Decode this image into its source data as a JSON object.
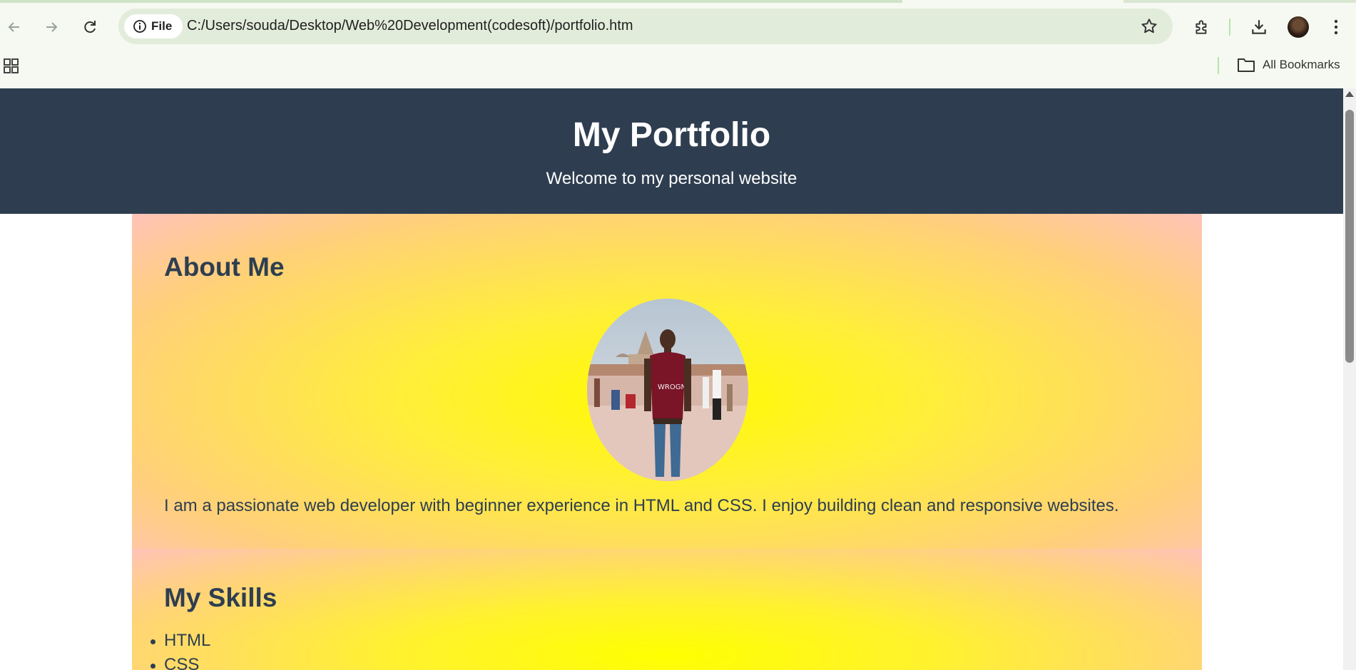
{
  "browser": {
    "site_chip_label": "File",
    "url": "C:/Users/souda/Desktop/Web%20Development(codesoft)/portfolio.htm",
    "bookmarks_label": "All Bookmarks",
    "icons": [
      "back-icon",
      "forward-icon",
      "reload-icon",
      "info-icon",
      "star-icon",
      "extensions-icon",
      "download-icon",
      "avatar",
      "menu-icon",
      "apps-icon",
      "folder-icon"
    ]
  },
  "header": {
    "title": "My Portfolio",
    "subtitle": "Welcome to my personal website"
  },
  "about": {
    "heading": "About Me",
    "text": "I am a passionate web developer with beginner experience in HTML and CSS. I enjoy building clean and responsive websites."
  },
  "skills": {
    "heading": "My Skills",
    "items": [
      "HTML",
      "CSS"
    ]
  },
  "colors": {
    "header_bg": "#2e3e50",
    "text": "#2e3e50",
    "gradient_center": "#fffb00",
    "gradient_edge": "#ffc3b8"
  }
}
